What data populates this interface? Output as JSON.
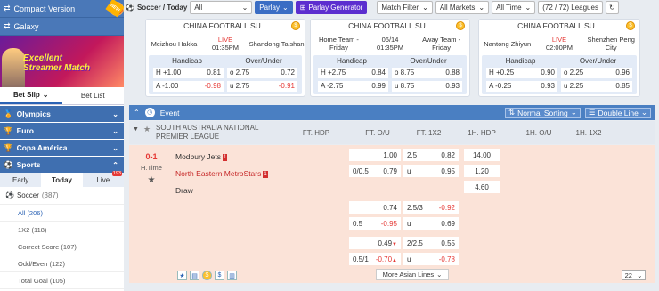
{
  "sidebar": {
    "compact_version": "Compact Version",
    "new_badge": "NEW",
    "galaxy": "Galaxy",
    "banner_title_1": "Excellent",
    "banner_title_2": "Streamer Match",
    "bet_slip": "Bet Slip",
    "bet_list": "Bet List",
    "categories": [
      "Olympics",
      "Euro",
      "Copa América",
      "Sports"
    ],
    "sub_tabs": [
      "Early",
      "Today",
      "Live"
    ],
    "live_count": "193",
    "sport": "Soccer",
    "sport_count": "(387)",
    "markets": [
      {
        "label": "All",
        "count": "(206)"
      },
      {
        "label": "1X2",
        "count": "(118)"
      },
      {
        "label": "Correct Score",
        "count": "(107)"
      },
      {
        "label": "Odd/Even",
        "count": "(122)"
      },
      {
        "label": "Total Goal",
        "count": "(105)"
      }
    ]
  },
  "toolbar": {
    "title": "Soccer / Today",
    "all_select": "All",
    "parlay": "Parlay",
    "parlay_generator": "Parlay Generator",
    "match_filter": "Match Filter",
    "all_markets": "All Markets",
    "all_time": "All Time",
    "leagues": "(72 / 72) Leagues"
  },
  "cards": [
    {
      "league": "CHINA FOOTBALL SU...",
      "home": "Meizhou Hakka",
      "status1": "LIVE",
      "status2": "01:35PM",
      "away": "Shandong Taishan",
      "handicap": "Handicap",
      "overunder": "Over/Under",
      "rows": [
        {
          "h_label": "H +1.00",
          "h_odds": "0.81",
          "ou_label": "o 2.75",
          "ou_odds": "0.72"
        },
        {
          "h_label": "A -1.00",
          "h_odds": "-0.98",
          "ou_label": "u 2.75",
          "ou_odds": "-0.91"
        }
      ]
    },
    {
      "league": "CHINA FOOTBALL SU...",
      "home": "Home Team - Friday",
      "status1": "06/14",
      "status2": "01:35PM",
      "away": "Away Team - Friday",
      "handicap": "Handicap",
      "overunder": "Over/Under",
      "rows": [
        {
          "h_label": "H +2.75",
          "h_odds": "0.84",
          "ou_label": "o 8.75",
          "ou_odds": "0.88"
        },
        {
          "h_label": "A -2.75",
          "h_odds": "0.99",
          "ou_label": "u 8.75",
          "ou_odds": "0.93"
        }
      ]
    },
    {
      "league": "CHINA FOOTBALL SU...",
      "home": "Nantong Zhiyun",
      "status1": "LIVE",
      "status2": "02:00PM",
      "away": "Shenzhen Peng City",
      "handicap": "Handicap",
      "overunder": "Over/Under",
      "rows": [
        {
          "h_label": "H +0.25",
          "h_odds": "0.90",
          "ou_label": "o 2.25",
          "ou_odds": "0.96"
        },
        {
          "h_label": "A -0.25",
          "h_odds": "0.93",
          "ou_label": "u 2.25",
          "ou_odds": "0.85"
        }
      ]
    }
  ],
  "event": {
    "header": "Event",
    "normal_sorting": "Normal Sorting",
    "double_line": "Double Line",
    "league": "SOUTH AUSTRALIA NATIONAL PREMIER LEAGUE",
    "cols": [
      "FT. HDP",
      "FT. O/U",
      "FT. 1X2",
      "1H. HDP",
      "1H. O/U",
      "1H. 1X2"
    ],
    "score": "0-1",
    "period": "H.Time",
    "home": "Modbury Jets",
    "home_cards": "1",
    "away": "North Eastern MetroStars",
    "away_cards": "1",
    "draw": "Draw",
    "odds": {
      "r1_hdp_odds": "1.00",
      "r1_ou_line": "2.5",
      "r1_ou_odds": "0.82",
      "r1_1x2": "14.00",
      "r2_hdp_line": "0/0.5",
      "r2_hdp_odds": "0.79",
      "r2_ou_line": "u",
      "r2_ou_odds": "0.95",
      "r2_1x2": "1.20",
      "r3_1x2": "4.60",
      "r4_hdp_odds": "0.74",
      "r4_ou_line": "2.5/3",
      "r4_ou_odds": "-0.92",
      "r5_hdp_line": "0.5",
      "r5_hdp_odds": "-0.95",
      "r5_ou_line": "u",
      "r5_ou_odds": "0.69",
      "r6_hdp_odds": "0.49",
      "r6_ou_line": "2/2.5",
      "r6_ou_odds": "0.55",
      "r7_hdp_line": "0.5/1",
      "r7_hdp_odds": "-0.70",
      "r7_ou_line": "u",
      "r7_ou_odds": "-0.78"
    },
    "more_lines": "More Asian Lines",
    "page_count": "22"
  }
}
